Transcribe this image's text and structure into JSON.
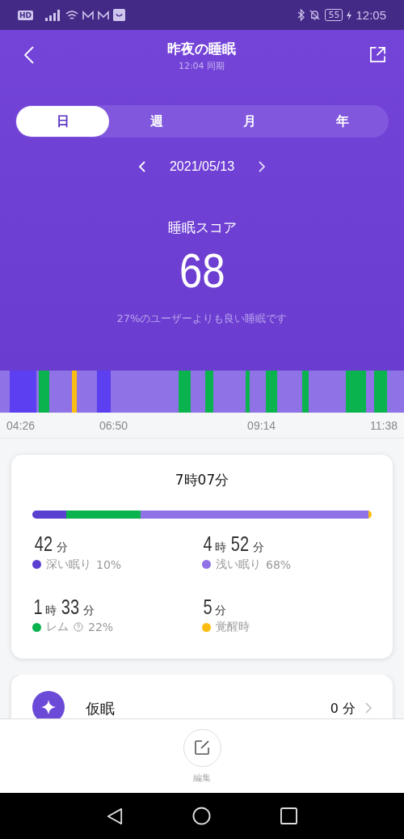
{
  "status_bar": {
    "left_badge": "HD",
    "battery": "55",
    "time": "12:05"
  },
  "header": {
    "title": "昨夜の睡眠",
    "subtitle": "12:04 同期"
  },
  "tabs": [
    {
      "label": "日",
      "selected": true
    },
    {
      "label": "週",
      "selected": false
    },
    {
      "label": "月",
      "selected": false
    },
    {
      "label": "年",
      "selected": false
    }
  ],
  "date": "2021/05/13",
  "score": {
    "label": "睡眠スコア",
    "value": "68",
    "note": "27%のユーザーよりも良い睡眠です"
  },
  "timeline": {
    "times": [
      "04:26",
      "06:50",
      "09:14",
      "11:38"
    ]
  },
  "summary": {
    "total": "7時07分",
    "stats": [
      {
        "parts": [
          {
            "kind": "number",
            "text": "42"
          },
          {
            "kind": "unit",
            "text": "分"
          }
        ],
        "label": "深い眠り",
        "percent": "10%",
        "color": "#5b3fd1",
        "level": 0.1,
        "help": false
      },
      {
        "parts": [
          {
            "kind": "number",
            "text": "4"
          },
          {
            "kind": "unit",
            "text": "時"
          },
          {
            "kind": "number",
            "text": "52"
          },
          {
            "kind": "unit",
            "text": "分"
          }
        ],
        "label": "浅い眠り",
        "percent": "68%",
        "color": "#8e72e6",
        "level": 0.67,
        "help": false
      },
      {
        "parts": [
          {
            "kind": "number",
            "text": "1"
          },
          {
            "kind": "unit",
            "text": "時"
          },
          {
            "kind": "number",
            "text": "33"
          },
          {
            "kind": "unit",
            "text": "分"
          }
        ],
        "label": "レム",
        "percent": "22%",
        "color": "#0bb34f",
        "level": 0.22,
        "help": true
      },
      {
        "parts": [
          {
            "kind": "number",
            "text": "5"
          },
          {
            "kind": "unit",
            "text": "分"
          }
        ],
        "label": "覚醒時",
        "color": "#fbbd12",
        "level": 0.01,
        "help": false
      }
    ]
  },
  "nap": {
    "label": "仮眠",
    "value": "0 分"
  },
  "bottom": {
    "edit_label": "編集"
  }
}
